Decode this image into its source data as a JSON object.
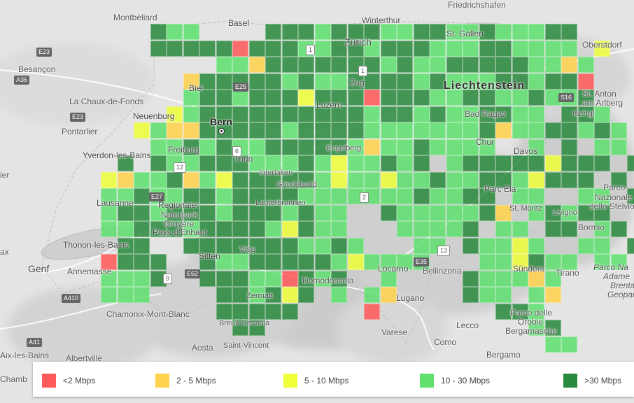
{
  "colors": {
    "lt2": "#ff5a5a",
    "2to5": "#ffd24d",
    "5to10": "#efff3a",
    "10to30": "#5fe06f",
    "gt30": "#2a8a3e"
  },
  "legend": [
    {
      "label": "<2 Mbps",
      "color": "#ff5a5a"
    },
    {
      "label": "2 - 5 Mbps",
      "color": "#ffd24d"
    },
    {
      "label": "5 - 10 Mbps",
      "color": "#efff3a"
    },
    {
      "label": "10 - 30 Mbps",
      "color": "#5fe06f"
    },
    {
      "label": ">30 Mbps",
      "color": "#2a8a3e"
    }
  ],
  "labels": {
    "basel": "Basel",
    "winterthur": "Winterthur",
    "friedrichshafen": "Friedrichshafen",
    "montbeliard": "Montbéliard",
    "zurich": "Zürich",
    "stgallen": "St. Gallen",
    "oberstdorf": "Oberstdorf",
    "besancon": "Besançon",
    "liechtenstein": "Liechtenstein",
    "biel": "Biel",
    "zug": "Zug",
    "chauxdefonds": "La Chaux-de-Fonds",
    "luzern": "Luzern",
    "stanton": "St. Anton",
    "amarlberg": "am Arlberg",
    "neuenburg": "Neuenburg",
    "badragaz": "Bad Ragaz",
    "ischgl": "Ischgl",
    "pontarlier": "Pontarlier",
    "bern": "Bern",
    "chur": "Chur",
    "yverdon": "Yverdon-les-Bains",
    "freiburg": "Freiburg",
    "engelberg": "Engelberg",
    "davos": "Davos",
    "thun": "Thun",
    "interlaken": "Interlaken",
    "grindelwald": "Grindelwald",
    "parcela": "Parc Ela",
    "parconazionale1": "Parco",
    "parconazionale2": "Nazionale",
    "parconazionale3": "dello Stelvio",
    "lausanne": "Lausanne",
    "regionaler": "Regionaler",
    "naturpark": "Naturpark",
    "gruyere": "Gruyère",
    "lauterbrunnen": "Lauterbrunnen",
    "stmoritz": "St. Moritz",
    "livigno": "Livigno",
    "paysdenhaut": "Pays-d'Enhaut",
    "bormio": "Bormio",
    "thonon": "Thonon-les-Bains",
    "sitten": "Sitten",
    "visp": "Visp",
    "ax": "ax",
    "genf": "Genf",
    "annemasse": "Annemasse",
    "locarno": "Locarno",
    "bellinzona": "Bellinzona",
    "sunders": "Sünders",
    "parcoadamello1": "Parco Na",
    "parcoadamello2": "Adame",
    "parcoadamello3": "Brenta",
    "parcoadamello4": "Geopar",
    "domodossola": "Domodossola",
    "tirano": "Tirano",
    "zermatt": "Zermatt",
    "lugano": "Lugano",
    "chamonix": "Chamonix-Mont-Blanc",
    "breuil": "Breuil-Cervinia",
    "parcodelle1": "Parco delle",
    "parcodelle2": "Orobie",
    "parcodelle3": "Bergamasche",
    "varese": "Varese",
    "lecco": "Lecco",
    "aixlesbains": "Aix-les-Bains",
    "aosta": "Aosta",
    "saintvincent": "Saint-Vincent",
    "como": "Como",
    "albertville": "Albertville",
    "bergamo": "Bergamo",
    "chamb": "Chamb",
    "ier": "ier"
  },
  "roads": {
    "e23a": "E23",
    "a36": "A36",
    "e23b": "E23",
    "s16": "S16",
    "e25": "E25",
    "e27": "E27",
    "e62": "E62",
    "e35": "E35",
    "a410": "A410",
    "a41": "A41",
    "n13": "13",
    "n1a": "1",
    "n1b": "1",
    "n2": "2",
    "n6": "6",
    "n9": "9",
    "n12": "12"
  }
}
